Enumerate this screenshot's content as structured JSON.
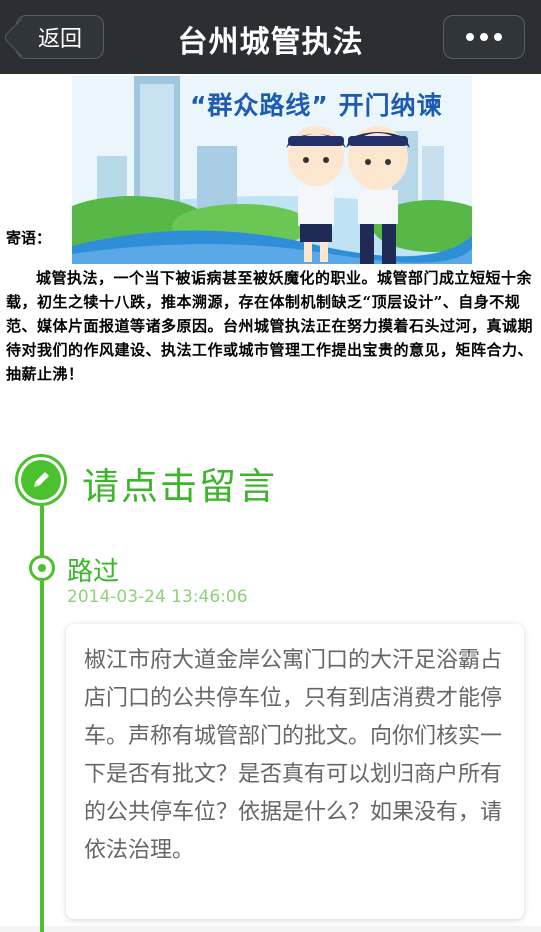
{
  "topbar": {
    "back_label": "返回",
    "title": "台州城管执法",
    "more_icon": "more-dots-icon"
  },
  "banner": {
    "slogan": "“群众路线” 开门纳谏",
    "colors": {
      "sky": "#dff1fb",
      "grass": "#3aa535",
      "water": "#2e8fd8",
      "slogan": "#1d5bb3"
    }
  },
  "intro": {
    "label": "寄语：",
    "body": "城管执法，一个当下被诟病甚至被妖魔化的职业。城管部门成立短短十余载，初生之犊十八跌，推本溯源，存在体制机制缺乏“顶层设计”、自身不规范、媒体片面报道等诸多原因。台州城管执法正在努力摸着石头过河，真诚期待对我们的作风建设、执法工作或城市管理工作提出宝贵的意见，矩阵合力、抽薪止沸！"
  },
  "leave_message": {
    "label": "请点击留言",
    "icon": "pencil-icon",
    "accent": "#4cc12e"
  },
  "messages": [
    {
      "author": "路过",
      "time": "2014-03-24 13:46:06",
      "text": "椒江市府大道金岸公寓门口的大汗足浴霸占店门口的公共停车位，只有到店消费才能停车。声称有城管部门的批文。向你们核实一下是否有批文？是否真有可以划归商户所有的公共停车位？依据是什么？如果没有，请依法治理。"
    }
  ]
}
